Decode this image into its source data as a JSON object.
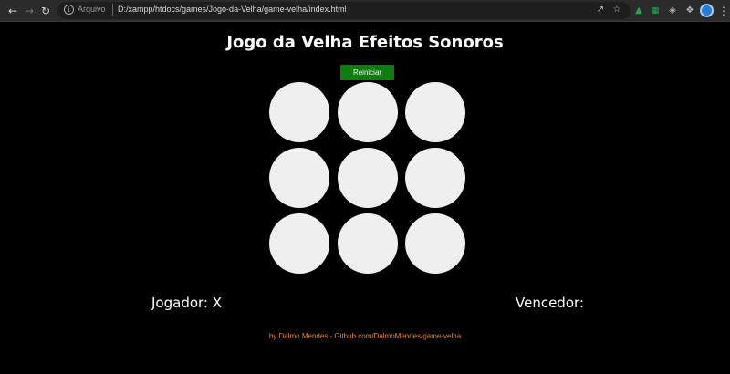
{
  "browser": {
    "security_label": "Arquivo",
    "url": "D:/xampp/htdocs/games/Jogo-da-Velha/game-velha/index.html",
    "icons": [
      "back-arrow-icon",
      "forward-arrow-icon",
      "reload-icon",
      "info-icon",
      "share-icon",
      "star-icon",
      "extension-icon",
      "profile-icon",
      "menu-icon"
    ]
  },
  "page": {
    "title": "Jogo da Velha Efeitos Sonoros",
    "restart_label": "Reiniciar",
    "board": {
      "cells": [
        "",
        "",
        "",
        "",
        "",
        "",
        "",
        "",
        ""
      ]
    },
    "player_label": "Jogador: X",
    "winner_label": "Vencedor:",
    "footer": "by Dalmo Mendes - Github.com/DalmoMendes/game-velha"
  },
  "colors": {
    "background": "#000000",
    "button": "#0f7d0f",
    "cell": "#efefef",
    "footer": "#e0873a"
  }
}
